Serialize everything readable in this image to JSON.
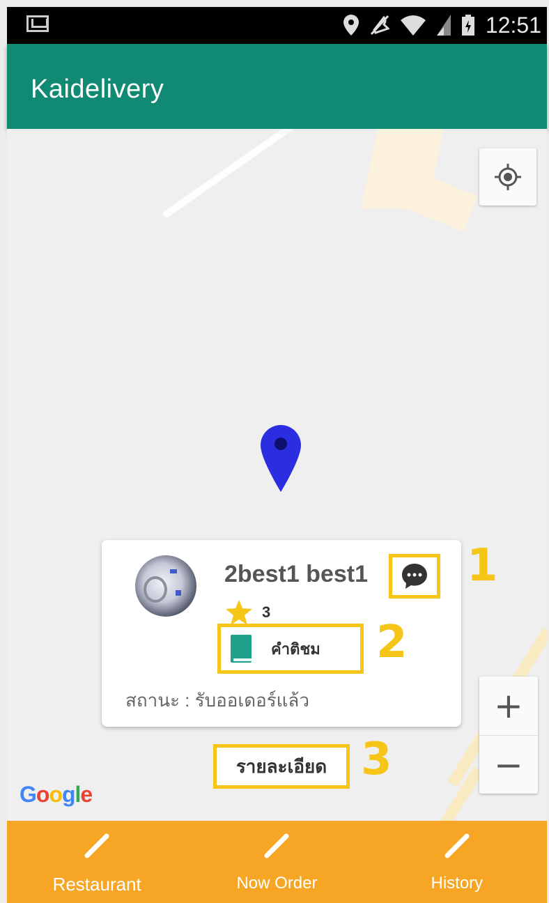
{
  "status_bar": {
    "notification_icon": "mail-icon",
    "icons": [
      "location-icon",
      "mute-icon",
      "wifi-icon",
      "signal-icon",
      "battery-icon"
    ],
    "time": "12:51"
  },
  "app_bar": {
    "title": "Kaidelivery",
    "color": "#108a72"
  },
  "map": {
    "logo": {
      "g1": "G",
      "o1": "o",
      "o2": "o",
      "g2": "g",
      "l": "l",
      "e": "e"
    },
    "locate_icon": "my-location-icon",
    "zoom_in": "+",
    "zoom_out": "−"
  },
  "info_card": {
    "name": "2best1 best1",
    "rating": "3",
    "review_label": "คำติชม",
    "status": "สถานะ : รับออเดอร์แล้ว",
    "chat_icon": "chat-bubble-icon",
    "review_icon": "book-icon",
    "star_icon": "star-icon"
  },
  "detail_button": {
    "label": "รายละเอียด"
  },
  "callouts": [
    "1",
    "2",
    "3"
  ],
  "highlight_color": "#f5c518",
  "bottom_nav": {
    "color": "#f6a624",
    "items": [
      {
        "label": "Restaurant",
        "icon": "pencil-icon"
      },
      {
        "label": "Now Order",
        "icon": "pencil-icon"
      },
      {
        "label": "History",
        "icon": "pencil-icon"
      }
    ]
  }
}
